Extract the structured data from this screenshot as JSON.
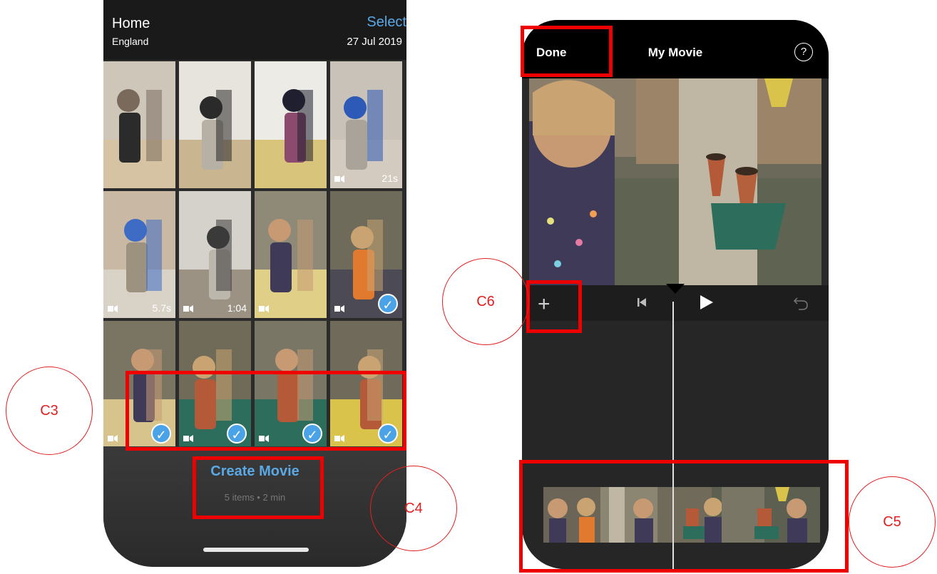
{
  "left_phone": {
    "header": {
      "title": "Home",
      "subtitle": "England",
      "select_label": "Select",
      "date": "27 Jul 2019"
    },
    "tiles": [
      {
        "duration": "",
        "video": false,
        "checked": false
      },
      {
        "duration": "",
        "video": false,
        "checked": false
      },
      {
        "duration": "",
        "video": false,
        "checked": false
      },
      {
        "duration": "21s",
        "video": true,
        "checked": false
      },
      {
        "duration": "5.7s",
        "video": true,
        "checked": false
      },
      {
        "duration": "1:04",
        "video": true,
        "checked": false
      },
      {
        "duration": "",
        "video": true,
        "checked": false
      },
      {
        "duration": "",
        "video": true,
        "checked": true
      },
      {
        "duration": "",
        "video": true,
        "checked": true
      },
      {
        "duration": "",
        "video": true,
        "checked": true
      },
      {
        "duration": "",
        "video": true,
        "checked": true
      },
      {
        "duration": "",
        "video": true,
        "checked": true
      }
    ],
    "create_movie_label": "Create Movie",
    "items_summary": "5 items • 2 min"
  },
  "right_phone": {
    "done_label": "Done",
    "title": "My Movie",
    "help_icon": "?",
    "toolbar": {
      "add_icon": "+",
      "rewind_icon": "skip-back-icon",
      "play_icon": "play-icon",
      "undo_icon": "undo-icon"
    }
  },
  "annotations": {
    "c3": "C3",
    "c4": "C4",
    "c5": "C5",
    "c6": "C6"
  },
  "colors": {
    "accent_blue": "#4aa3e6",
    "annotation_red": "#ee0000"
  }
}
